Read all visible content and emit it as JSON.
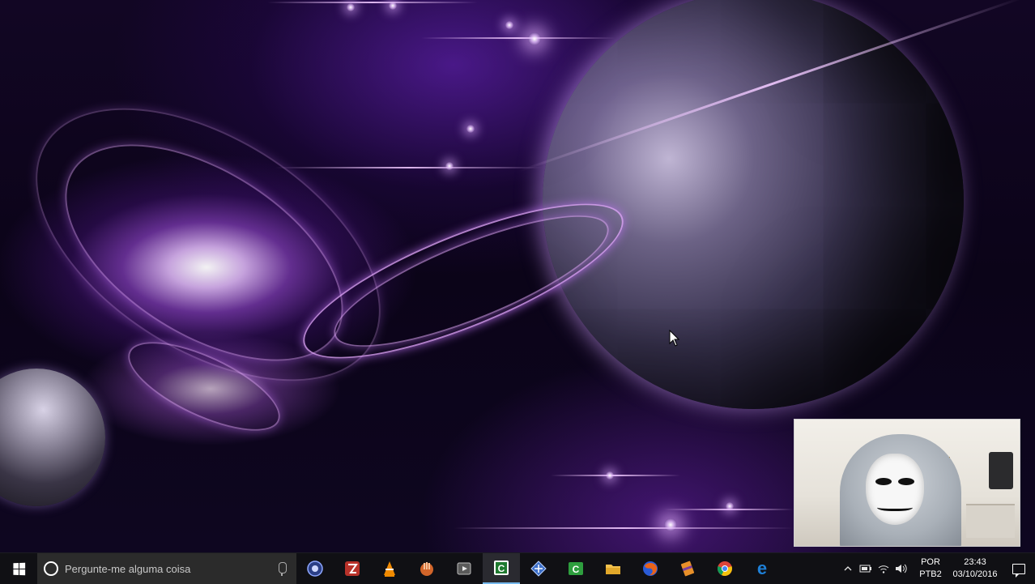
{
  "desktop": {
    "wallpaper": "purple galaxy with ringed planet",
    "cursor_icon": "arrow-cursor-icon",
    "colors": {
      "accent": "#9b3df0",
      "glow": "#e2b6ff"
    }
  },
  "webcam": {
    "label": "webcam-overlay"
  },
  "taskbar": {
    "start_icon": "windows-logo-icon",
    "search": {
      "icon": "cortana-icon",
      "placeholder": "Pergunte-me alguma coisa",
      "mic_icon": "microphone-icon"
    },
    "apps": [
      {
        "name": "cinema4d-icon",
        "color": "#3050a8",
        "glyph": ""
      },
      {
        "name": "filezilla-icon",
        "color": "#c33b2a",
        "glyph": ""
      },
      {
        "name": "vlc-icon",
        "color": "#f08a00",
        "glyph": ""
      },
      {
        "name": "hand-app-icon",
        "color": "#d2652a",
        "glyph": ""
      },
      {
        "name": "media-player-icon",
        "color": "#6e6e6e",
        "glyph": ""
      },
      {
        "name": "camtasia-icon",
        "color": "#3aa54a",
        "glyph": "C"
      },
      {
        "name": "network-app-icon",
        "color": "#4a7bd0",
        "glyph": ""
      },
      {
        "name": "camtasia-recorder-icon",
        "color": "#2e9e3e",
        "glyph": "C"
      },
      {
        "name": "file-explorer-icon",
        "color": "#f2c14e",
        "glyph": ""
      },
      {
        "name": "firefox-icon",
        "color": "#e2691e",
        "glyph": ""
      },
      {
        "name": "winrar-icon",
        "color": "#e8902a",
        "glyph": ""
      },
      {
        "name": "chrome-icon",
        "color": "#3aa65a",
        "glyph": ""
      },
      {
        "name": "edge-icon",
        "color": "#1e7fd6",
        "glyph": "e"
      }
    ],
    "active_app_index": 5,
    "tray": {
      "icons": [
        "chevron-up-icon",
        "battery-icon",
        "wifi-icon",
        "volume-icon"
      ],
      "language_line1": "POR",
      "language_line2": "PTB2",
      "time": "23:43",
      "date": "03/10/2016",
      "notification_icon": "action-center-icon"
    }
  }
}
